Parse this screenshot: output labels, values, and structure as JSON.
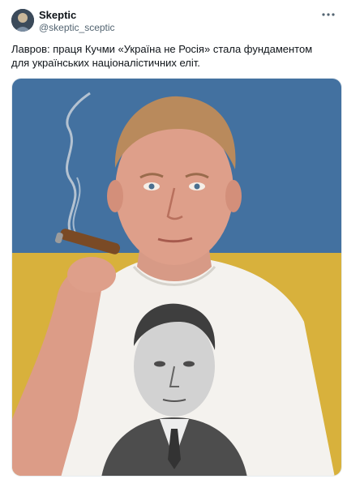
{
  "author": {
    "display_name": "Skeptic",
    "handle": "@skeptic_sceptic"
  },
  "post": {
    "text": "Лавров: праця Кучми «Україна не Росія» стала фундаментом для українських націоналістичних еліт."
  },
  "icons": {
    "more": "more-horizontal-icon"
  },
  "colors": {
    "flag_blue": "#4a78a8",
    "flag_yellow": "#d8b13c",
    "shirt": "#f4f2ee",
    "text_primary": "#0f1419",
    "text_secondary": "#536471"
  }
}
